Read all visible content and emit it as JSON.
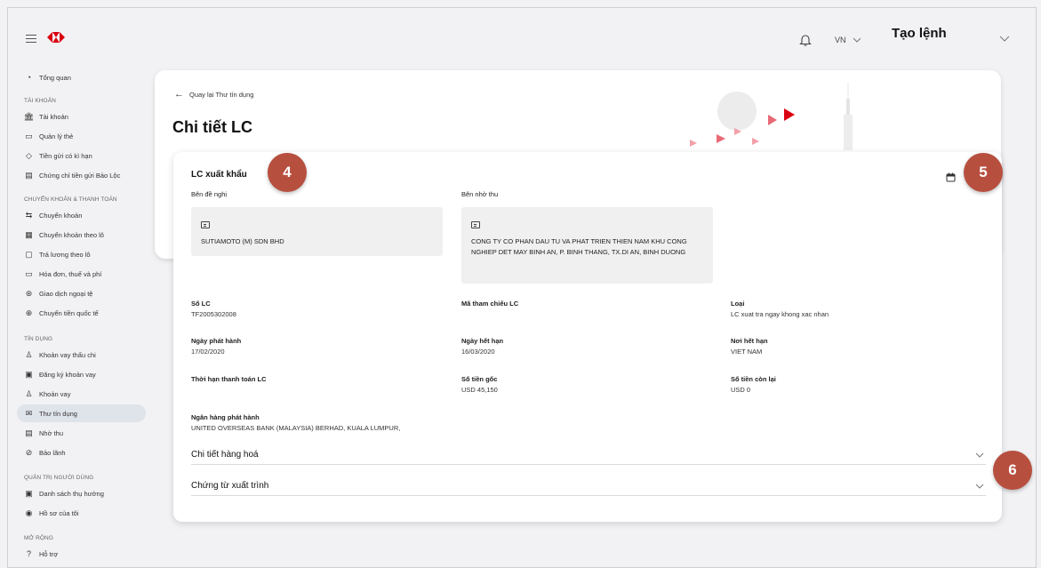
{
  "topbar": {
    "language": "VN",
    "create_order": "Tạo lệnh"
  },
  "sidebar": {
    "overview": "Tổng quan",
    "sections": {
      "accounts": "TÀI KHOẢN",
      "transfer": "CHUYỂN KHOẢN & THANH TOÁN",
      "credit": "TÍN DỤNG",
      "user_admin": "QUẢN TRỊ NGƯỜI DÙNG",
      "extension": "MỞ RỘNG"
    },
    "items": [
      {
        "label": "Tài khoản",
        "icon": "bank-icon"
      },
      {
        "label": "Quản lý thẻ",
        "icon": "card-icon"
      },
      {
        "label": "Tiền gửi có kì hạn",
        "icon": "deposit-icon"
      },
      {
        "label": "Chứng chỉ tiền gửi Bảo Lộc",
        "icon": "certificate-icon"
      },
      {
        "label": "Chuyển khoản",
        "icon": "transfer-icon"
      },
      {
        "label": "Chuyển khoản theo lô",
        "icon": "batch-transfer-icon"
      },
      {
        "label": "Trả lương theo lô",
        "icon": "payroll-icon"
      },
      {
        "label": "Hóa đơn, thuế và phí",
        "icon": "bill-icon"
      },
      {
        "label": "Giao dịch ngoại tệ",
        "icon": "fx-icon"
      },
      {
        "label": "Chuyển tiền quốc tế",
        "icon": "globe-icon"
      },
      {
        "label": "Khoản vay thấu chi",
        "icon": "overdraft-icon"
      },
      {
        "label": "Đăng ký khoản vay",
        "icon": "loan-register-icon"
      },
      {
        "label": "Khoản vay",
        "icon": "loan-icon"
      },
      {
        "label": "Thư tín dụng",
        "icon": "letter-icon"
      },
      {
        "label": "Nhờ thu",
        "icon": "collection-icon"
      },
      {
        "label": "Bảo lãnh",
        "icon": "guarantee-icon"
      },
      {
        "label": "Danh sách thụ hưởng",
        "icon": "beneficiary-icon"
      },
      {
        "label": "Hồ sơ của tôi",
        "icon": "profile-icon"
      },
      {
        "label": "Hỗ trợ",
        "icon": "help-icon"
      }
    ]
  },
  "header": {
    "back_link": "Quay lại Thư tín dụng",
    "title": "Chi tiết LC"
  },
  "detail": {
    "title": "LC xuất khẩu",
    "applicant_label": "Bên đề nghị",
    "applicant_name": "SUTIAMOTO (M) SDN BHD",
    "collector_label": "Bên nhờ thu",
    "collector_name": "CONG TY CO PHAN DAU TU VA PHAT TRIEN THIEN NAM KHU CONG NGHIEP DET MAY BINH AN, P. BINH THANG, TX.DI AN, BINH DUONG",
    "fields": {
      "lc_no_label": "Số LC",
      "lc_no": "TF2005302008",
      "ref_label": "Mã tham chiếu LC",
      "ref": "",
      "type_label": "Loại",
      "type": "LC xuat tra ngay khong xac nhan",
      "issue_label": "Ngày phát hành",
      "issue": "17/02/2020",
      "expiry_label": "Ngày hết hạn",
      "expiry": "16/03/2020",
      "expiry_place_label": "Nơi hết hạn",
      "expiry_place": "VIET NAM",
      "term_label": "Thời hạn thanh toán LC",
      "term": "",
      "original_label": "Số tiền gốc",
      "original": "USD 45,150",
      "remaining_label": "Số tiền còn lại",
      "remaining": "USD 0",
      "issuing_bank_label": "Ngân hàng phát hành",
      "issuing_bank": "UNITED OVERSEAS BANK (MALAYSIA) BERHAD, KUALA LUMPUR,"
    },
    "accordion": {
      "goods": "Chi tiết hàng hoá",
      "documents": "Chứng từ xuất trình"
    }
  },
  "markers": [
    "4",
    "5",
    "6"
  ],
  "colors": {
    "brand_red": "#db0011",
    "marker": "#b74f3f",
    "active_bg": "#dfe3ea"
  }
}
